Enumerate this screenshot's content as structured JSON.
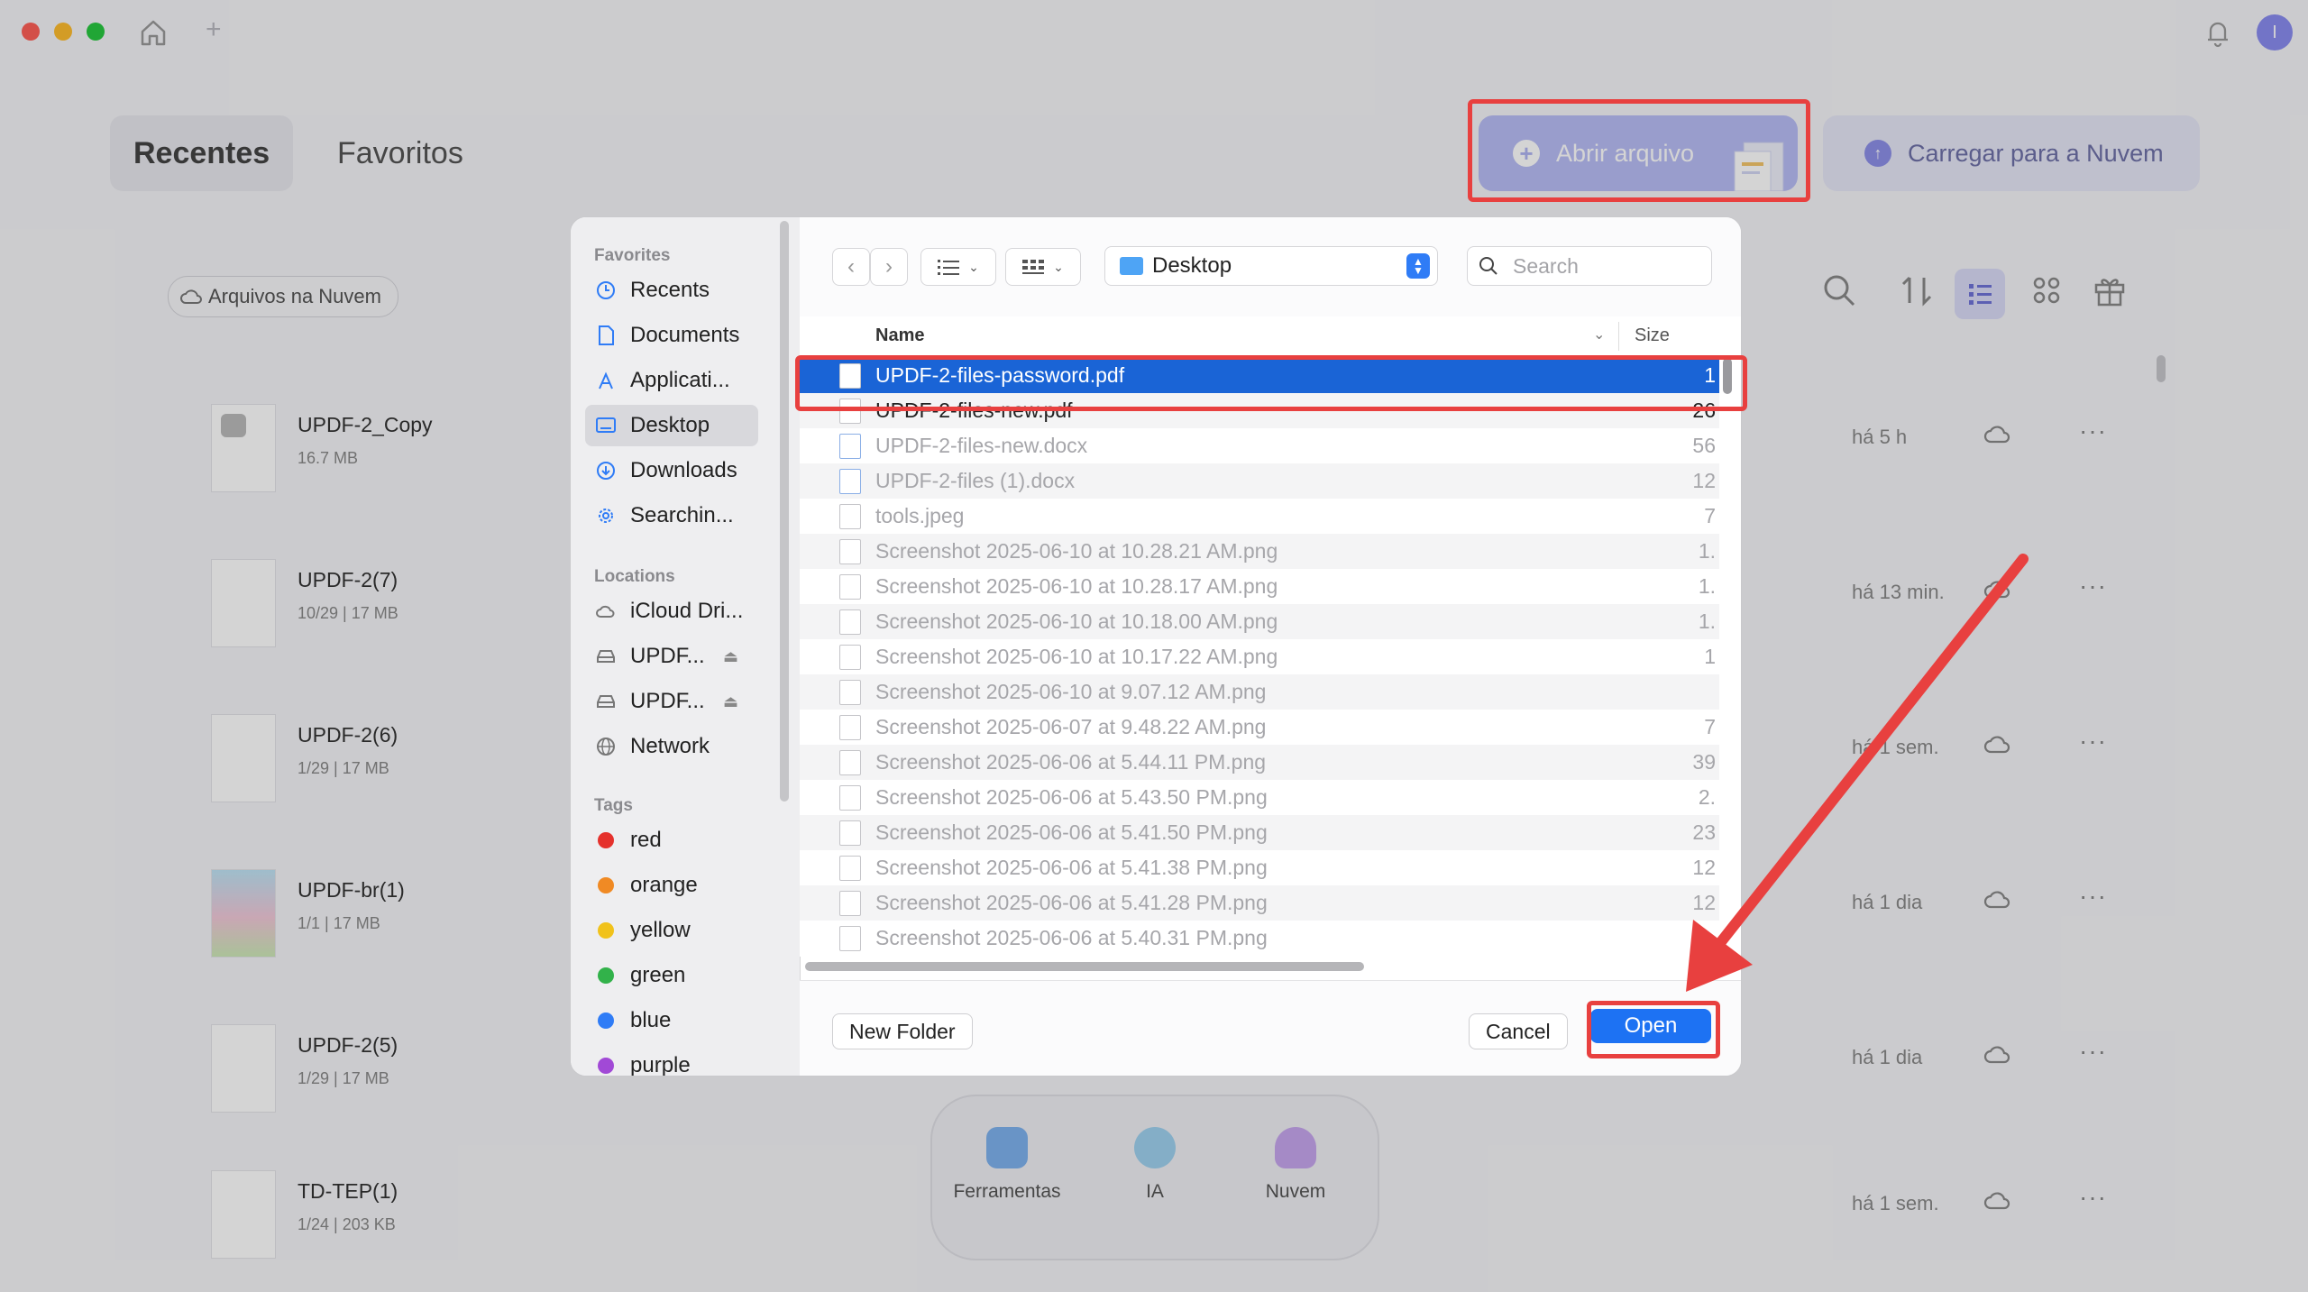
{
  "app": {
    "tabs": [
      "Recentes",
      "Favoritos"
    ],
    "open_file_label": "Abrir arquivo",
    "cloud_upload_label": "Carregar para a Nuvem",
    "cloud_files_chip": "Arquivos na Nuvem",
    "avatar_initial": "I",
    "files": [
      {
        "name": "UPDF-2_Copy",
        "meta": "16.7 MB",
        "time": "há 5 h"
      },
      {
        "name": "UPDF-2(7)",
        "meta": "10/29  |  17 MB",
        "time": "há 13 min."
      },
      {
        "name": "UPDF-2(6)",
        "meta": "1/29  |  17 MB",
        "time": "há 1 sem."
      },
      {
        "name": "UPDF-br(1)",
        "meta": "1/1  |  17 MB",
        "time": "há 1 dia"
      },
      {
        "name": "UPDF-2(5)",
        "meta": "1/29  |  17 MB",
        "time": "há 1 dia"
      },
      {
        "name": "TD-TEP(1)",
        "meta": "1/24  |  203 KB",
        "time": "há 1 sem."
      }
    ],
    "dock": [
      "Ferramentas",
      "IA",
      "Nuvem"
    ]
  },
  "dialog": {
    "sidebar": {
      "favorites_heading": "Favorites",
      "favorites": [
        "Recents",
        "Documents",
        "Applicati...",
        "Desktop",
        "Downloads",
        "Searchin..."
      ],
      "locations_heading": "Locations",
      "locations": [
        "iCloud Dri...",
        "UPDF...",
        "UPDF...",
        "Network"
      ],
      "tags_heading": "Tags",
      "tags": [
        {
          "name": "red",
          "color": "#e5312c"
        },
        {
          "name": "orange",
          "color": "#f08a24"
        },
        {
          "name": "yellow",
          "color": "#f1c21b"
        },
        {
          "name": "green",
          "color": "#32b24a"
        },
        {
          "name": "blue",
          "color": "#2f7cf6"
        },
        {
          "name": "purple",
          "color": "#a149d6"
        }
      ]
    },
    "location": "Desktop",
    "search_placeholder": "Search",
    "columns": {
      "name": "Name",
      "size": "Size"
    },
    "files": [
      {
        "name": "UPDF-2-files-password.pdf",
        "size": "1"
      },
      {
        "name": "UPDF-2-files-new.pdf",
        "size": "26"
      },
      {
        "name": "UPDF-2-files-new.docx",
        "size": "56"
      },
      {
        "name": "UPDF-2-files (1).docx",
        "size": "12"
      },
      {
        "name": "tools.jpeg",
        "size": "7"
      },
      {
        "name": "Screenshot 2025-06-10 at 10.28.21 AM.png",
        "size": "1."
      },
      {
        "name": "Screenshot 2025-06-10 at 10.28.17 AM.png",
        "size": "1."
      },
      {
        "name": "Screenshot 2025-06-10 at 10.18.00 AM.png",
        "size": "1."
      },
      {
        "name": "Screenshot 2025-06-10 at 10.17.22 AM.png",
        "size": "1"
      },
      {
        "name": "Screenshot 2025-06-10 at 9.07.12 AM.png",
        "size": ""
      },
      {
        "name": "Screenshot 2025-06-07 at 9.48.22 AM.png",
        "size": "7"
      },
      {
        "name": "Screenshot 2025-06-06 at 5.44.11 PM.png",
        "size": "39"
      },
      {
        "name": "Screenshot 2025-06-06 at 5.43.50 PM.png",
        "size": "2."
      },
      {
        "name": "Screenshot 2025-06-06 at 5.41.50 PM.png",
        "size": "23"
      },
      {
        "name": "Screenshot 2025-06-06 at 5.41.38 PM.png",
        "size": "12"
      },
      {
        "name": "Screenshot 2025-06-06 at 5.41.28 PM.png",
        "size": "12"
      },
      {
        "name": "Screenshot 2025-06-06 at 5.40.31 PM.png",
        "size": ""
      }
    ],
    "new_folder_label": "New Folder",
    "cancel_label": "Cancel",
    "open_label": "Open"
  },
  "colors": {
    "accent": "#1d72f3",
    "highlight": "#e8403f",
    "selection": "#1a64d6"
  }
}
